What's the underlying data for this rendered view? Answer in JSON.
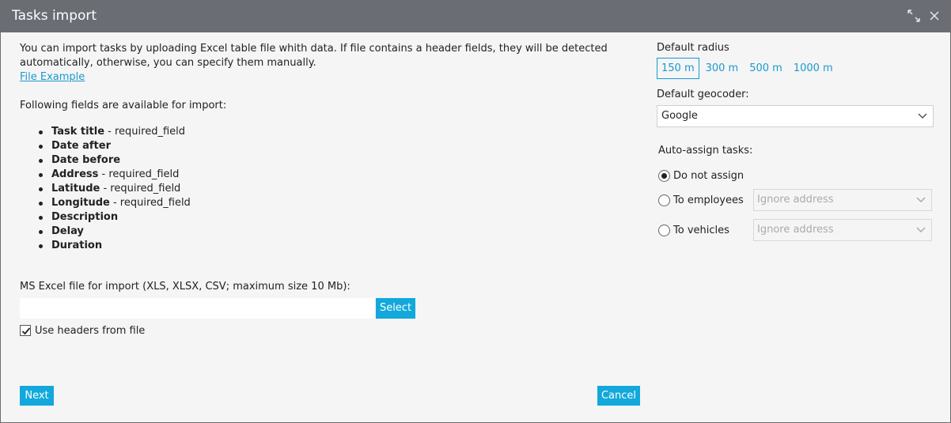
{
  "window": {
    "title": "Tasks import"
  },
  "intro": {
    "text": "You can import tasks by uploading Excel table file whith data. If file contains a header fields, they will be detected automatically, otherwise, you can specify them manually.",
    "example_link": "File Example"
  },
  "fields_title": "Following fields are available for import:",
  "fields": [
    {
      "name": "Task title",
      "note": " - required_field"
    },
    {
      "name": "Date after",
      "note": ""
    },
    {
      "name": "Date before",
      "note": ""
    },
    {
      "name": "Address",
      "note": " - required_field"
    },
    {
      "name": "Latitude",
      "note": " - required_field"
    },
    {
      "name": "Longitude",
      "note": " - required_field"
    },
    {
      "name": "Description",
      "note": ""
    },
    {
      "name": "Delay",
      "note": ""
    },
    {
      "name": "Duration",
      "note": ""
    }
  ],
  "file": {
    "label": "MS Excel file for import (XLS, XLSX, CSV; maximum size 10 Mb):",
    "value": "",
    "select_label": "Select",
    "use_headers_label": "Use headers from file",
    "use_headers_checked": true
  },
  "radius": {
    "label": "Default radius",
    "options": [
      "150 m",
      "300 m",
      "500 m",
      "1000 m"
    ],
    "selected": "150 m"
  },
  "geocoder": {
    "label": "Default geocoder:",
    "value": "Google"
  },
  "auto_assign": {
    "label": "Auto-assign tasks:",
    "options": [
      {
        "label": "Do not assign",
        "selected": true
      },
      {
        "label": "To employees",
        "selected": false,
        "sub_value": "Ignore address"
      },
      {
        "label": "To vehicles",
        "selected": false,
        "sub_value": "Ignore address"
      }
    ]
  },
  "footer": {
    "next_label": "Next",
    "cancel_label": "Cancel"
  },
  "colors": {
    "accent": "#12a8dc",
    "titlebar": "#6a6d73",
    "link": "#1a9ad0"
  }
}
